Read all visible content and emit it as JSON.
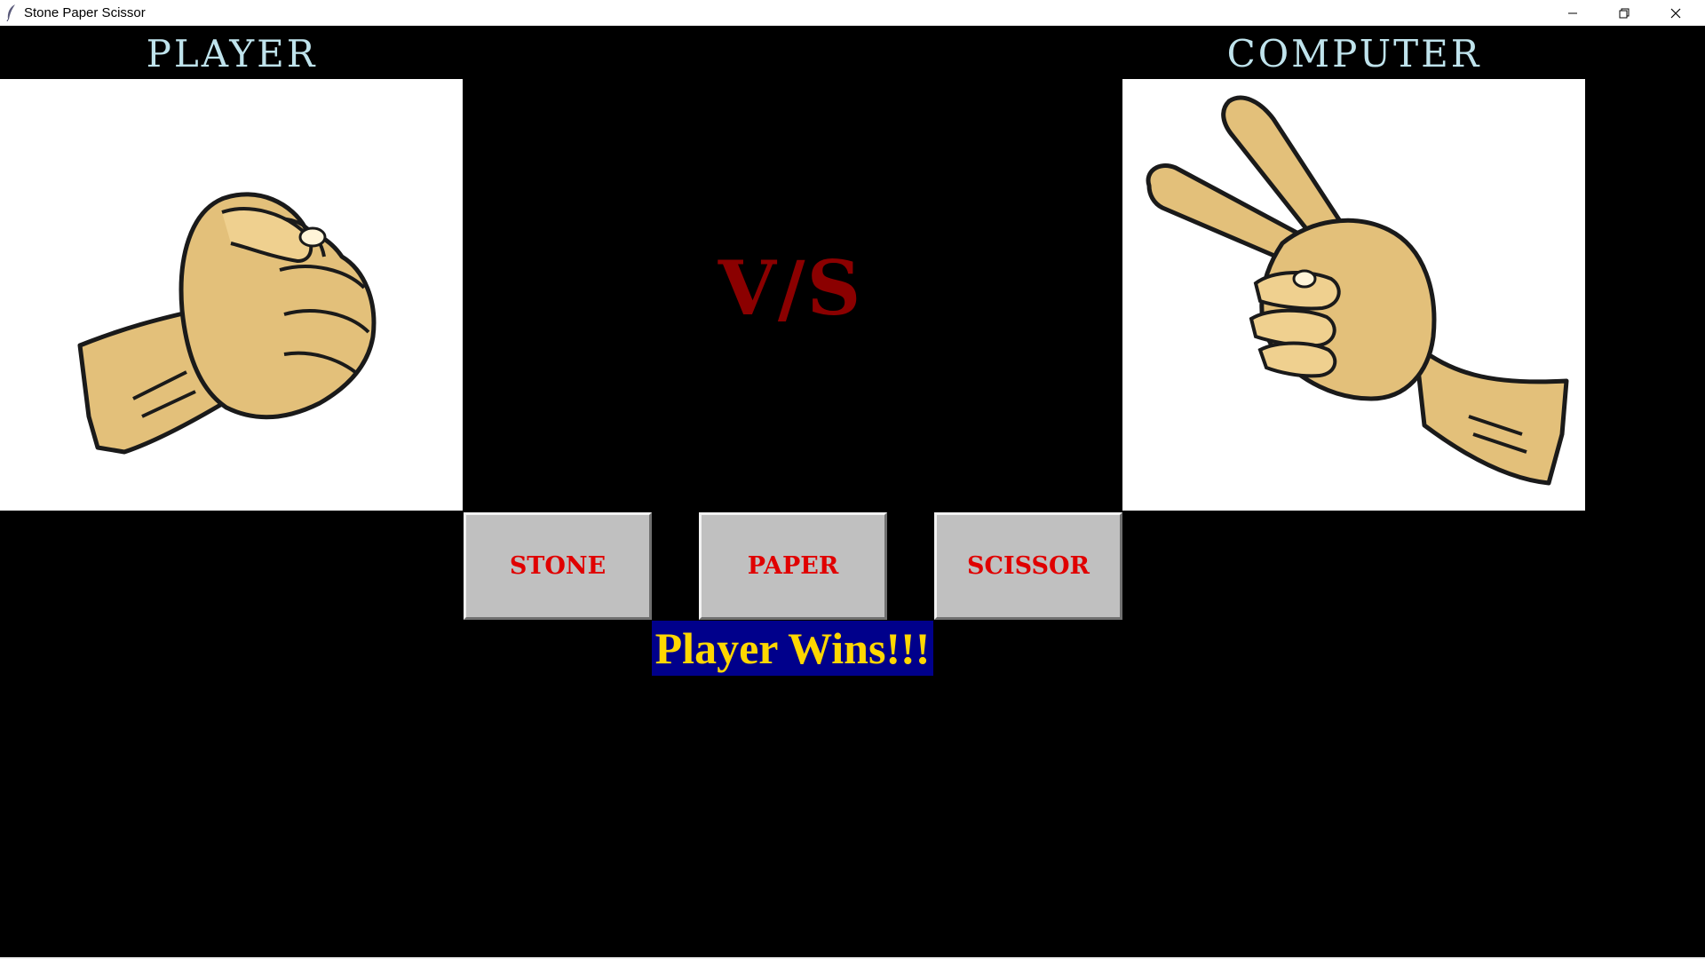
{
  "window": {
    "title": "Stone Paper Scissor",
    "icon": "feather-icon",
    "controls": [
      "minimize-icon",
      "restore-icon",
      "close-icon"
    ]
  },
  "headings": {
    "player": "PLAYER",
    "computer": "COMPUTER"
  },
  "player_choice": {
    "hand": "stone",
    "icon": "fist-hand-icon"
  },
  "computer_choice": {
    "hand": "scissor",
    "icon": "scissor-hand-icon"
  },
  "vs_label": "V/S",
  "buttons": {
    "stone": "STONE",
    "paper": "PAPER",
    "scissor": "SCISSOR"
  },
  "result": "Player Wins!!!",
  "colors": {
    "background": "#000000",
    "heading": "#bfe3ec",
    "vs": "#8b0000",
    "button_bg": "#c0c0c0",
    "button_text": "#e00000",
    "result_bg": "#00008b",
    "result_text": "#ffd700",
    "skin": "#e3c07a"
  }
}
